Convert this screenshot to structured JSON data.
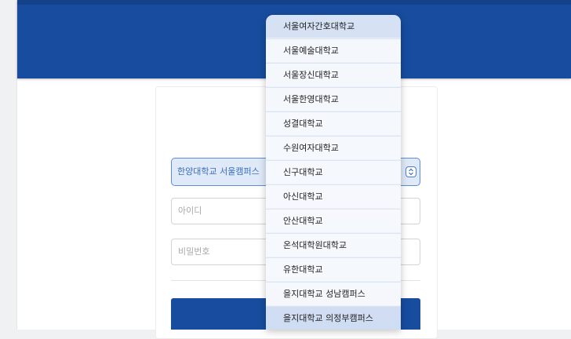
{
  "form": {
    "campus_select_value": "한양대학교 서울캠퍼스",
    "id_placeholder": "아이디",
    "password_placeholder": "비밀번호"
  },
  "dropdown": {
    "options": [
      "서울여자간호대학교",
      "서울예술대학교",
      "서울장신대학교",
      "서울한영대학교",
      "성결대학교",
      "수원여자대학교",
      "신구대학교",
      "아신대학교",
      "안산대학교",
      "온석대학원대학교",
      "유한대학교",
      "을지대학교 성남캠퍼스",
      "을지대학교 의정부캠퍼스"
    ]
  },
  "colors": {
    "header": "#174c9f",
    "select_border": "#5a8fd8",
    "select_text": "#3a6fb8"
  }
}
